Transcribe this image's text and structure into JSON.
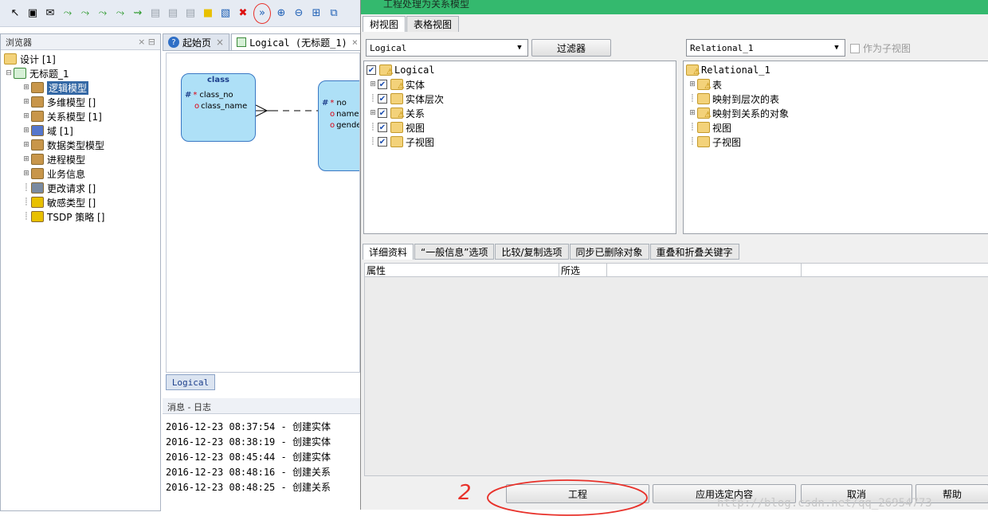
{
  "browser": {
    "title": "浏览器",
    "root": "设计 [1]",
    "project": "无标题_1",
    "items": [
      {
        "label": "逻辑模型",
        "selected": true
      },
      {
        "label": "多维模型 []"
      },
      {
        "label": "关系模型 [1]"
      },
      {
        "label": "域 [1]"
      },
      {
        "label": "数据类型模型"
      },
      {
        "label": "进程模型"
      },
      {
        "label": "业务信息"
      },
      {
        "label": "更改请求 []"
      },
      {
        "label": "敏感类型 []"
      },
      {
        "label": "TSDP 策略 []"
      }
    ]
  },
  "doc_tabs": [
    {
      "label": "起始页"
    },
    {
      "label": "Logical (无标题_1)",
      "active": true
    }
  ],
  "diagram": {
    "entity1": {
      "title": "class",
      "attr1": "class_no",
      "attr2": "class_name"
    },
    "entity2": {
      "attr1": "no",
      "attr2": "name",
      "attr3": "gender"
    },
    "bottom_tab": "Logical"
  },
  "messages": {
    "title": "消息 - 日志",
    "lines": [
      "2016-12-23 08:37:54 - 创建实体",
      "2016-12-23 08:38:19 - 创建实体",
      "2016-12-23 08:45:44 - 创建实体",
      "2016-12-23 08:48:16 - 创建关系",
      "2016-12-23 08:48:25 - 创建关系"
    ]
  },
  "dialog": {
    "title": "工程处理为关系模型",
    "view_tabs": [
      "树视图",
      "表格视图"
    ],
    "left_combo": "Logical",
    "filter_button": "过滤器",
    "right_combo": "Relational_1",
    "subview_checkbox": "作为子视图",
    "left_tree": {
      "root": "Logical",
      "items": [
        "实体",
        "实体层次",
        "关系",
        "视图",
        "子视图"
      ]
    },
    "right_tree": {
      "root": "Relational_1",
      "items": [
        "表",
        "映射到层次的表",
        "映射到关系的对象",
        "视图",
        "子视图"
      ]
    },
    "detail_tabs": [
      "详细资料",
      "“一般信息”选项",
      "比较/复制选项",
      "同步已删除对象",
      "重叠和折叠关键字"
    ],
    "table_headers": [
      "属性",
      "所选"
    ],
    "buttons": {
      "engineer": "工程",
      "apply": "应用选定内容",
      "cancel": "取消",
      "help": "帮助"
    }
  },
  "annotation": {
    "text": "2",
    "color": "#e8312a"
  },
  "watermark": "http://blog.csdn.net/qq_26954773"
}
